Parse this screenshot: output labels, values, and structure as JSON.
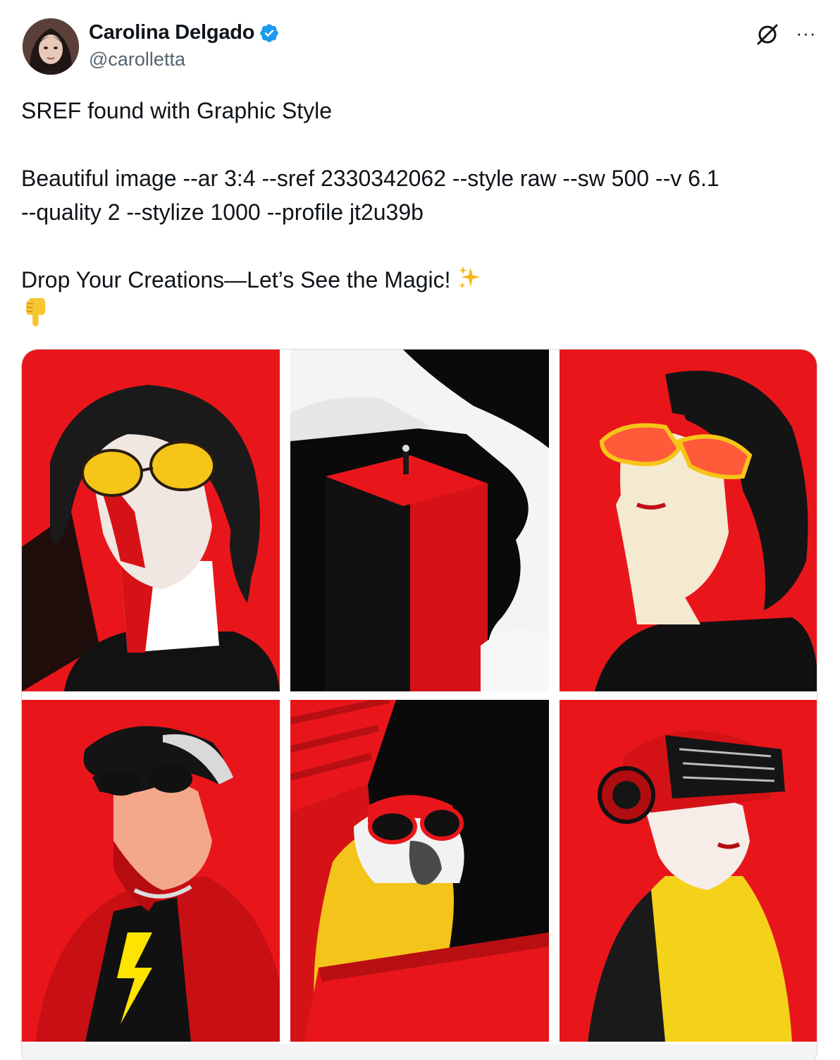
{
  "author": {
    "display_name": "Carolina Delgado",
    "handle": "@carolletta",
    "verified": true,
    "avatar_icon": "profile-photo"
  },
  "actions": {
    "grok_icon": "grok-icon",
    "more_icon": "more-options-icon",
    "more_label": "···"
  },
  "post": {
    "line1": "SREF found with Graphic Style",
    "line2": "Beautiful image --ar 3:4 --sref 2330342062 --style raw --sw 500 --v 6.1",
    "line3": "--quality 2 --stylize 1000 --profile jt2u39b",
    "line4": "Drop Your Creations—Let’s See the Magic! ",
    "sparkles_emoji": "✨",
    "pointing_emoji": "👇"
  },
  "media": {
    "count": 6,
    "items": [
      {
        "name": "curly-hair-man-yellow-aviators",
        "icon": "image"
      },
      {
        "name": "red-tower-in-clouds",
        "icon": "image"
      },
      {
        "name": "bob-hair-woman-red-glasses",
        "icon": "image"
      },
      {
        "name": "man-in-cap-red-jacket",
        "icon": "image"
      },
      {
        "name": "parrot-with-red-sunglasses",
        "icon": "image"
      },
      {
        "name": "woman-with-vr-headset",
        "icon": "image"
      }
    ]
  },
  "colors": {
    "text_primary": "#0f1419",
    "text_secondary": "#536471",
    "verified_blue": "#1d9bf0",
    "art_red": "#e8161b",
    "art_yellow": "#f5c518",
    "border": "#cfd9de"
  }
}
